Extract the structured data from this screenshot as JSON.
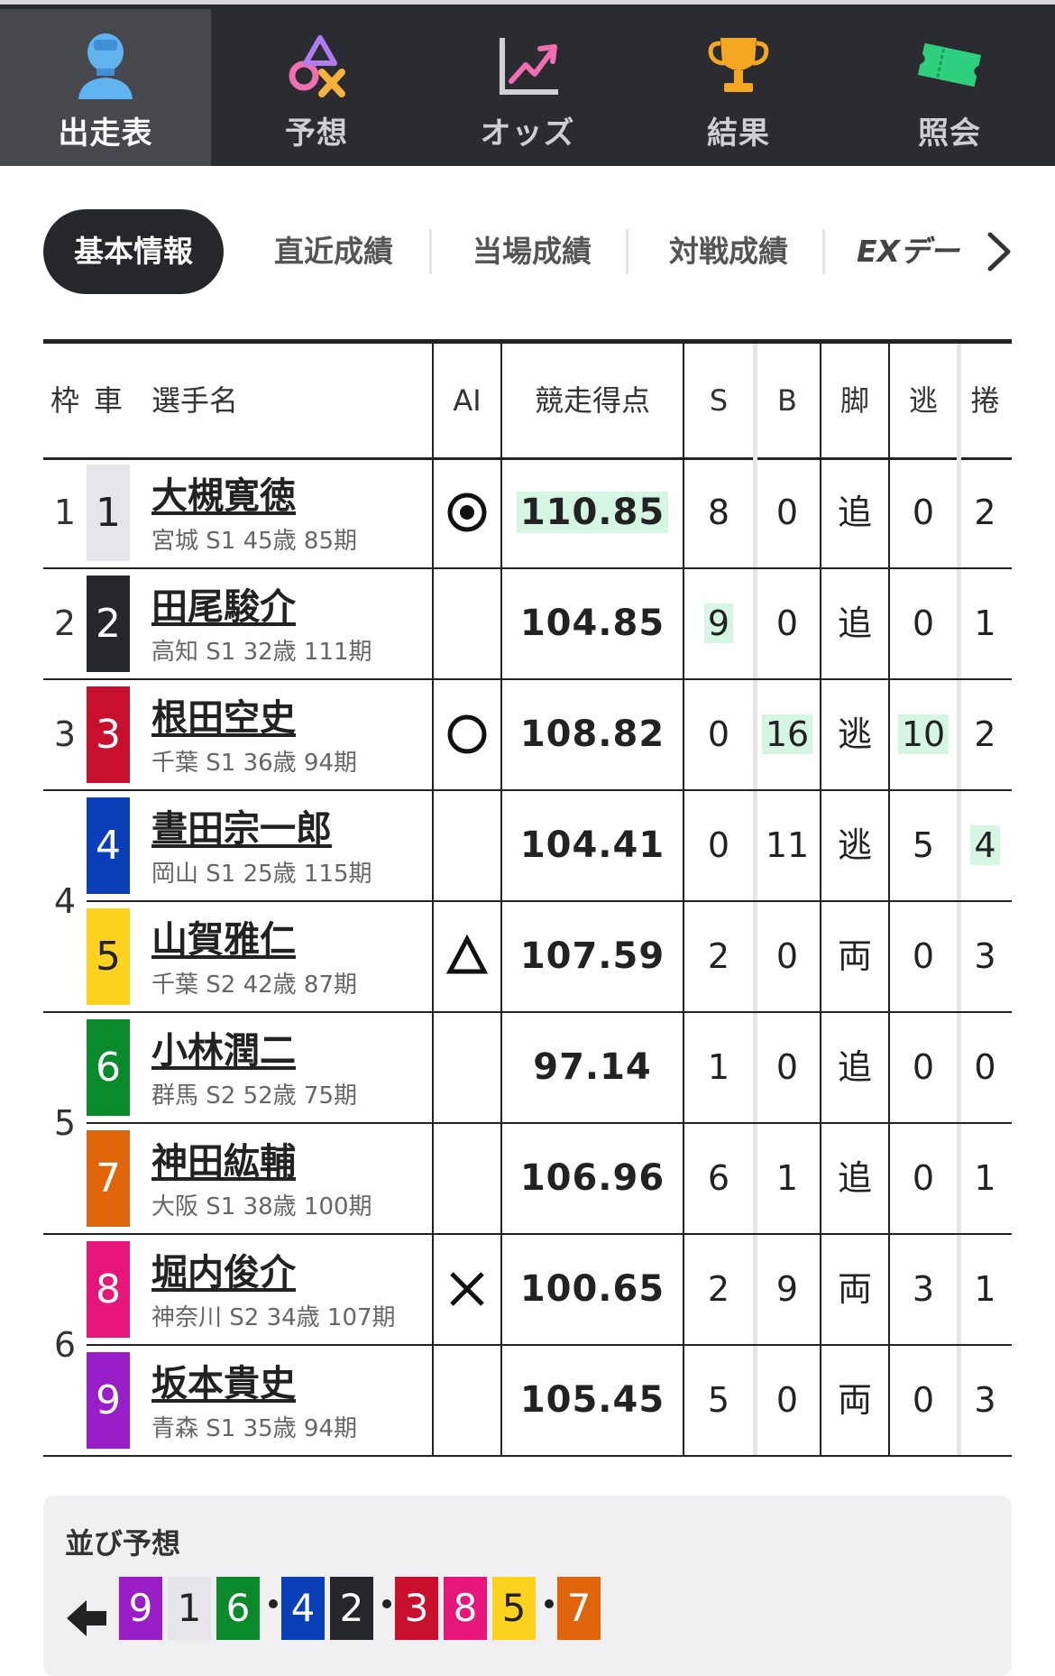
{
  "nav": [
    {
      "label": "出走表",
      "icon": "racer-icon",
      "active": true
    },
    {
      "label": "予想",
      "icon": "prediction-icon",
      "active": false
    },
    {
      "label": "オッズ",
      "icon": "odds-chart-icon",
      "active": false
    },
    {
      "label": "結果",
      "icon": "trophy-icon",
      "active": false
    },
    {
      "label": "照会",
      "icon": "ticket-icon",
      "active": false
    }
  ],
  "tabs": {
    "active": "基本情報",
    "items": [
      "直近成績",
      "当場成績",
      "対戦成績",
      "EXデー"
    ],
    "more_icon": "chevron-right-icon"
  },
  "table": {
    "headers": {
      "waku": "枠",
      "car": "車",
      "name": "選手名",
      "ai": "AI",
      "score": "競走得点",
      "s": "S",
      "b": "B",
      "leg": "脚",
      "nige": "逃",
      "makuri": "捲"
    },
    "rows": [
      {
        "waku": "1",
        "car": "1",
        "name": "大槻寛徳",
        "info": "宮城 S1 45歳 85期",
        "ai": "double-circle",
        "score": "110.85",
        "s": "8",
        "b": "0",
        "leg": "追",
        "nige": "0",
        "makuri": "2"
      },
      {
        "waku": "2",
        "car": "2",
        "name": "田尾駿介",
        "info": "高知 S1 32歳 111期",
        "ai": "",
        "score": "104.85",
        "s": "9",
        "b": "0",
        "leg": "追",
        "nige": "0",
        "makuri": "1"
      },
      {
        "waku": "3",
        "car": "3",
        "name": "根田空史",
        "info": "千葉 S1 36歳 94期",
        "ai": "circle",
        "score": "108.82",
        "s": "0",
        "b": "16",
        "leg": "逃",
        "nige": "10",
        "makuri": "2"
      },
      {
        "waku": "4",
        "car": "4",
        "name": "晝田宗一郎",
        "info": "岡山 S1 25歳 115期",
        "ai": "",
        "score": "104.41",
        "s": "0",
        "b": "11",
        "leg": "逃",
        "nige": "5",
        "makuri": "4"
      },
      {
        "waku": "",
        "car": "5",
        "name": "山賀雅仁",
        "info": "千葉 S2 42歳 87期",
        "ai": "triangle",
        "score": "107.59",
        "s": "2",
        "b": "0",
        "leg": "両",
        "nige": "0",
        "makuri": "3"
      },
      {
        "waku": "5",
        "car": "6",
        "name": "小林潤二",
        "info": "群馬 S2 52歳 75期",
        "ai": "",
        "score": "97.14",
        "s": "1",
        "b": "0",
        "leg": "追",
        "nige": "0",
        "makuri": "0"
      },
      {
        "waku": "",
        "car": "7",
        "name": "神田紘輔",
        "info": "大阪 S1 38歳 100期",
        "ai": "",
        "score": "106.96",
        "s": "6",
        "b": "1",
        "leg": "追",
        "nige": "0",
        "makuri": "1"
      },
      {
        "waku": "6",
        "car": "8",
        "name": "堀内俊介",
        "info": "神奈川 S2 34歳 107期",
        "ai": "cross",
        "score": "100.65",
        "s": "2",
        "b": "9",
        "leg": "両",
        "nige": "3",
        "makuri": "1"
      },
      {
        "waku": "",
        "car": "9",
        "name": "坂本貴史",
        "info": "青森 S1 35歳 94期",
        "ai": "",
        "score": "105.45",
        "s": "5",
        "b": "0",
        "leg": "両",
        "nige": "0",
        "makuri": "3"
      }
    ],
    "highlights": {
      "score_row": 0,
      "s_row": 1,
      "b_row": 2,
      "nige_row": 2,
      "makuri_row": 3
    }
  },
  "car_colors": {
    "1": {
      "bg": "#e6e6ea",
      "fg": "#222222"
    },
    "2": {
      "bg": "#26272b",
      "fg": "#ffffff"
    },
    "3": {
      "bg": "#c8102e",
      "fg": "#ffffff"
    },
    "4": {
      "bg": "#0b3fb8",
      "fg": "#ffffff"
    },
    "5": {
      "bg": "#ffd21f",
      "fg": "#222222"
    },
    "6": {
      "bg": "#0a8a2a",
      "fg": "#ffffff"
    },
    "7": {
      "bg": "#e0650a",
      "fg": "#ffffff"
    },
    "8": {
      "bg": "#e6167a",
      "fg": "#ffffff"
    },
    "9": {
      "bg": "#9a1ec8",
      "fg": "#ffffff"
    }
  },
  "lineup": {
    "title": "並び予想",
    "groups": [
      [
        "9",
        "1"
      ],
      [
        "6"
      ],
      [
        "4",
        "2"
      ],
      [
        "3",
        "8"
      ],
      [
        "5"
      ],
      [
        "7"
      ]
    ],
    "display": [
      "9",
      "1",
      "6",
      "·",
      "4",
      "2",
      "·",
      "3",
      "8",
      "5",
      "·",
      "7"
    ]
  }
}
